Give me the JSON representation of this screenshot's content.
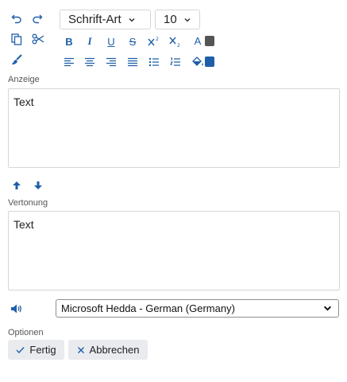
{
  "toolbar": {
    "font_family": "Schrift-Art",
    "font_size": "10",
    "bold": "B",
    "italic": "I",
    "underline": "U",
    "strike": "S",
    "text_color_letter": "A"
  },
  "colors": {
    "accent": "#1f5fa8",
    "text_color_swatch": "#555555",
    "fill_color_swatch": "#1f5fa8"
  },
  "icons": {
    "undo": "undo-icon",
    "redo": "redo-icon",
    "copy": "copy-icon",
    "cut": "scissors-icon",
    "format_painter": "brush-icon",
    "superscript": "superscript-icon",
    "subscript": "subscript-icon",
    "align_left": "align-left-icon",
    "align_center": "align-center-icon",
    "align_right": "align-right-icon",
    "justify": "justify-icon",
    "bullet_list": "bullet-list-icon",
    "numbered_list": "numbered-list-icon",
    "fill_color": "paint-bucket-icon",
    "move_up": "arrow-up-icon",
    "move_down": "arrow-down-icon",
    "speaker": "speaker-icon"
  },
  "anzeige": {
    "label": "Anzeige",
    "text": "Text"
  },
  "vertonung": {
    "label": "Vertonung",
    "text": "Text"
  },
  "voice": {
    "selected": "Microsoft Hedda - German (Germany)"
  },
  "options": {
    "label": "Optionen",
    "ok": "Fertig",
    "cancel": "Abbrechen"
  }
}
